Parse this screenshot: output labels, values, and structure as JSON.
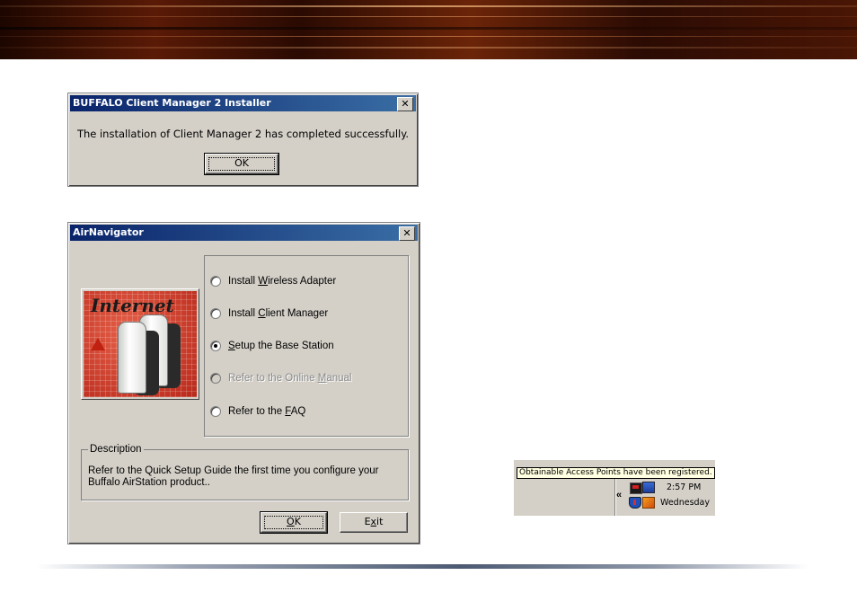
{
  "installer": {
    "title": "BUFFALO Client Manager 2 Installer",
    "message": "The installation of Client Manager 2 has completed successfully.",
    "ok_label": "OK"
  },
  "airnav": {
    "title": "AirNavigator",
    "illustration_text": "Internet",
    "options": [
      {
        "pre": "Install ",
        "u": "W",
        "post": "ireless Adapter",
        "selected": false,
        "enabled": true
      },
      {
        "pre": "Install ",
        "u": "C",
        "post": "lient Manager",
        "selected": false,
        "enabled": true
      },
      {
        "pre": "",
        "u": "S",
        "post": "etup the Base Station",
        "selected": true,
        "enabled": true
      },
      {
        "pre": "Refer to the Online ",
        "u": "M",
        "post": "anual",
        "selected": false,
        "enabled": false
      },
      {
        "pre": "Refer to the ",
        "u": "F",
        "post": "AQ",
        "selected": false,
        "enabled": true
      }
    ],
    "description_title": "Description",
    "description_text": "Refer to the Quick Setup Guide the first time you configure your Buffalo AirStation product..",
    "ok_u": "O",
    "ok_rest": "K",
    "exit_pre": "E",
    "exit_u": "x",
    "exit_post": "it"
  },
  "tray": {
    "tooltip": "Obtainable Access Points have been registered.",
    "chevron": "«",
    "time": "2:57 PM",
    "day": "Wednesday"
  },
  "colors": {
    "titlebar_start": "#0a246a",
    "titlebar_end": "#3a6ea5",
    "dialog_face": "#d4d0c8",
    "tooltip_bg": "#ffffe1"
  }
}
